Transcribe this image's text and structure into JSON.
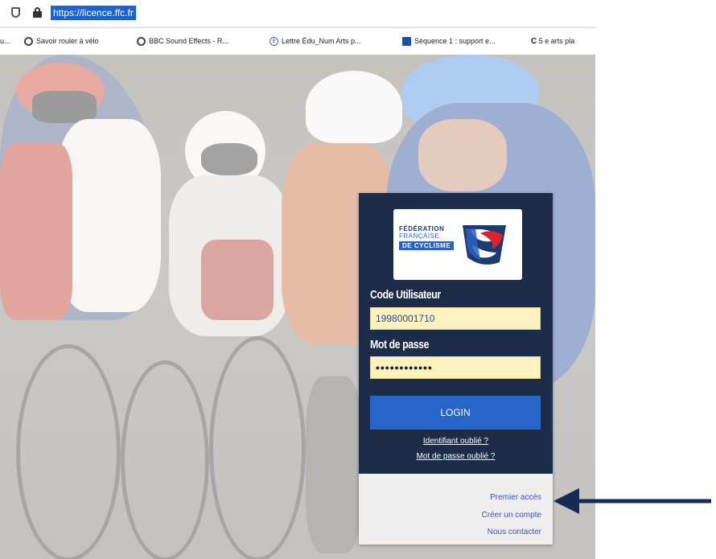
{
  "browser": {
    "url": "https://licence.ffc.fr"
  },
  "bookmarks": [
    {
      "label": "u...",
      "icon": "none"
    },
    {
      "label": "Savoir rouler à vélo",
      "icon": "globe-icon"
    },
    {
      "label": "BBC Sound Effects - R...",
      "icon": "globe-icon"
    },
    {
      "label": "Lettre Édu_Num Arts p...",
      "icon": "edu-icon"
    },
    {
      "label": "Séquence 1 : support e...",
      "icon": "square-icon"
    },
    {
      "label": "5 e arts pla",
      "icon": "c-icon"
    }
  ],
  "logo": {
    "line1": "FÉDÉRATION",
    "line2": "FRANÇAISE",
    "line3": "DE CYCLISME"
  },
  "login": {
    "user_label": "Code Utilisateur",
    "user_value": "19980001710",
    "password_label": "Mot de passe",
    "password_value": "••••••••••••",
    "login_button": "LOGIN",
    "forgot_id": "Identifiant oublié ?",
    "forgot_password": "Mot de passe oublié ?"
  },
  "footer": {
    "first_access": "Premier accès",
    "create_account": "Créer un compte",
    "contact": "Nous contacter"
  },
  "colors": {
    "card": "#1d2c48",
    "login_button": "#2766c9",
    "field_bg": "#fcf1bf",
    "arrow": "#152a55"
  }
}
